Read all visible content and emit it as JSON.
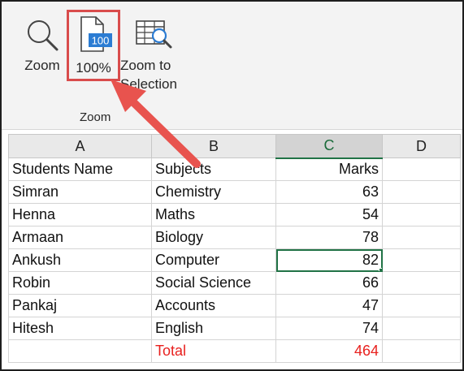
{
  "ribbon": {
    "zoom_label": "Zoom",
    "zoom100_label": "100%",
    "zoom100_badge": "100",
    "zoom_to_selection_line1": "Zoom to",
    "zoom_to_selection_line2": "Selection",
    "group_label": "Zoom"
  },
  "sheet": {
    "columns": [
      "A",
      "B",
      "C",
      "D"
    ],
    "selected_column": "C",
    "rows": [
      [
        "Students Name",
        "Subjects",
        "Marks",
        ""
      ],
      [
        "Simran",
        "Chemistry",
        "63",
        ""
      ],
      [
        "Henna",
        "Maths",
        "54",
        ""
      ],
      [
        "Armaan",
        "Biology",
        "78",
        ""
      ],
      [
        "Ankush",
        "Computer",
        "82",
        ""
      ],
      [
        "Robin",
        "Social Science",
        "66",
        ""
      ],
      [
        "Pankaj",
        "Accounts",
        "47",
        ""
      ],
      [
        "Hitesh",
        "English",
        "74",
        ""
      ],
      [
        "",
        "Total",
        "464",
        ""
      ]
    ]
  },
  "colors": {
    "highlight": "#d94c4c",
    "selection": "#217346",
    "total_text": "#e8201e"
  },
  "icons": {
    "zoom": "magnifier-icon",
    "zoom100": "page-100-icon",
    "zoom_selection": "grid-magnifier-icon",
    "annotation": "red-arrow"
  }
}
